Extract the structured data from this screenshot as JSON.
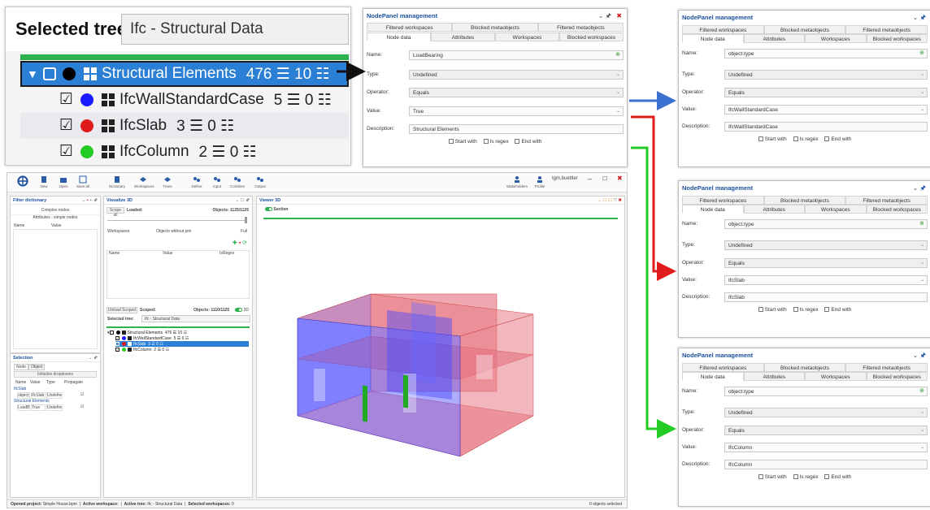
{
  "zoomed_tree": {
    "label": "Selected tree:",
    "selected_value": "Ifc - Structural Data",
    "items": [
      {
        "name": "Structural Elements",
        "count": "476 ☰ 10 ☷",
        "color": "#000000"
      },
      {
        "name": "IfcWallStandardCase",
        "count": "5 ☰ 0 ☷",
        "color": "#1a1aff"
      },
      {
        "name": "IfcSlab",
        "count": "3 ☰ 0 ☷",
        "color": "#e01b1b"
      },
      {
        "name": "IfcColumn",
        "count": "2 ☰ 0 ☷",
        "color": "#22cc22"
      }
    ]
  },
  "panels": [
    {
      "title": "NodePanel management",
      "tabs_row1": [
        "Filtered workspaces",
        "Blocked metaobjects",
        "Filtered metaobjects"
      ],
      "tabs_row2": [
        "Node data",
        "Attributes",
        "Workspaces",
        "Blocked workspaces"
      ],
      "name_label": "Name:",
      "name_value": "LoadBearing",
      "type_label": "Type:",
      "type_value": "Undefined",
      "operator_label": "Operator:",
      "operator_value": "Equals",
      "value_label": "Value:",
      "value_value": "True",
      "description_label": "Description:",
      "description_value": "Structural Elements",
      "opt_start": "Start with",
      "opt_regex": "Is regex",
      "opt_end": "End with"
    },
    {
      "title": "NodePanel management",
      "tabs_row1": [
        "Filtered workspaces",
        "Blocked metaobjects",
        "Filtered metaobjects"
      ],
      "tabs_row2": [
        "Node data",
        "Attributes",
        "Workspaces",
        "Blocked workspaces"
      ],
      "name_label": "Name:",
      "name_value": "object.type",
      "type_label": "Type:",
      "type_value": "Undefined",
      "operator_label": "Operator:",
      "operator_value": "Equals",
      "value_label": "Value:",
      "value_value": "IfcWallStandardCase",
      "description_label": "Description:",
      "description_value": "IfcWallStandardCase",
      "opt_start": "Start with",
      "opt_regex": "Is regex",
      "opt_end": "End with"
    },
    {
      "title": "NodePanel management",
      "tabs_row1": [
        "Filtered workspaces",
        "Blocked metaobjects",
        "Filtered metaobjects"
      ],
      "tabs_row2": [
        "Node data",
        "Attributes",
        "Workspaces",
        "Blocked workspaces"
      ],
      "name_label": "Name:",
      "name_value": "object.type",
      "type_label": "Type:",
      "type_value": "Undefined",
      "operator_label": "Operator:",
      "operator_value": "Equals",
      "value_label": "Value:",
      "value_value": "IfcSlab",
      "description_label": "Description:",
      "description_value": "IfcSlab",
      "opt_start": "Start with",
      "opt_regex": "Is regex",
      "opt_end": "End with"
    },
    {
      "title": "NodePanel management",
      "tabs_row1": [
        "Filtered workspaces",
        "Blocked metaobjects",
        "Filtered metaobjects"
      ],
      "tabs_row2": [
        "Node data",
        "Attributes",
        "Workspaces",
        "Blocked workspaces"
      ],
      "name_label": "Name:",
      "name_value": "object.type",
      "type_label": "Type:",
      "type_value": "Undefined",
      "operator_label": "Operator:",
      "operator_value": "Equals",
      "value_label": "Value:",
      "value_value": "IfcColumn",
      "description_label": "Description:",
      "description_value": "IfcColumn",
      "opt_start": "Start with",
      "opt_regex": "Is regex",
      "opt_end": "End with"
    }
  ],
  "arrow_colors": {
    "black": "#111111",
    "blue": "#3b6fd1",
    "red": "#e01b1b",
    "green": "#22cc22"
  },
  "app": {
    "ribbon": [
      "New",
      "Open",
      "Save all",
      "Dictionary",
      "Workspaces",
      "Trees",
      "Define",
      "Input",
      "Combine",
      "Output"
    ],
    "ribbon_right": [
      "Stakeholders",
      "Profile",
      "tgm.buettler"
    ],
    "filter_dictionary": {
      "title": "Filter dictionary",
      "complex": "Complex nodes",
      "simple": "Attributes - simple nodes",
      "col_name": "Name",
      "col_value": "Value"
    },
    "selection": {
      "title": "Selection",
      "tab_node": "Node",
      "tab_object": "Object",
      "init": "Initialize dropdowns",
      "cols": [
        "Name",
        "Value",
        "Type",
        "Propagate"
      ],
      "group1": "IfcSlab",
      "row1": [
        "object",
        "IfcSlab",
        "Undefine",
        "☑"
      ],
      "group2": "Structural Elements",
      "row2": [
        "LoadB",
        "True",
        "Undefine",
        "☑"
      ]
    },
    "visualize": {
      "title": "Visualize 3D",
      "scope_all": "Scope all",
      "loaded": "Loaded:",
      "objects_total": "Objects: 1125/1125",
      "workspaces": "Workspaces",
      "without_join": "Objects without join",
      "full": "Full",
      "col_name": "Name",
      "col_value": "Value",
      "col_regex": "IsRegex",
      "unload": "Unload Scoped",
      "scoped": "Scoped:",
      "objects_scoped": "Objects: 1110/1125",
      "mode_3d": "3D",
      "selected_tree_label": "Selected tree:",
      "selected_tree_value": "Ifc - Structural Data",
      "tree": [
        {
          "name": "Structural Elements",
          "count": "476 ☰ 10 ☷",
          "color": "#000000"
        },
        {
          "name": "IfcWallStandardCase",
          "count": "5 ☰ 0 ☷",
          "color": "#1a1aff"
        },
        {
          "name": "IfcSlab",
          "count": "3 ☰ 0 ☷",
          "color": "#e01b1b"
        },
        {
          "name": "IfcColumn",
          "count": "2 ☰ 0 ☷",
          "color": "#22cc22"
        }
      ]
    },
    "viewer": {
      "title": "Viewer 3D",
      "section": "Section"
    },
    "status": {
      "opened_label": "Opened project:",
      "opened_value": "Simple House.bpm",
      "workspace_label": "Active workspace:",
      "tree_label": "Active tree:",
      "tree_value": "Ifc - Structural Data",
      "selected_label": "Selected workspaces:",
      "selected_value": "0",
      "objects_selected": "0 objects selected"
    }
  }
}
